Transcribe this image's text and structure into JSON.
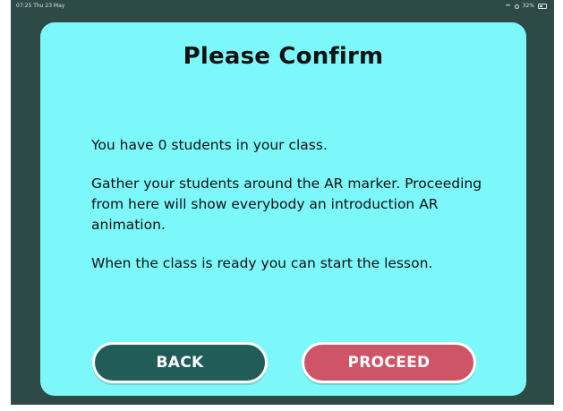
{
  "status_bar": {
    "time_date": "07:25  Thu 23 May",
    "battery_text": "32%"
  },
  "dialog": {
    "title": "Please Confirm",
    "paragraphs": [
      "You have 0 students in your class.",
      "Gather your students around the AR marker. Proceeding from here will show everybody an introduction AR animation.",
      "When the class is ready you can start the lesson."
    ],
    "buttons": {
      "back_label": "BACK",
      "proceed_label": "PROCEED"
    }
  },
  "colors": {
    "background": "#2d4a47",
    "card": "#7df8fa",
    "back_button": "#205d59",
    "proceed_button": "#ce5568"
  }
}
